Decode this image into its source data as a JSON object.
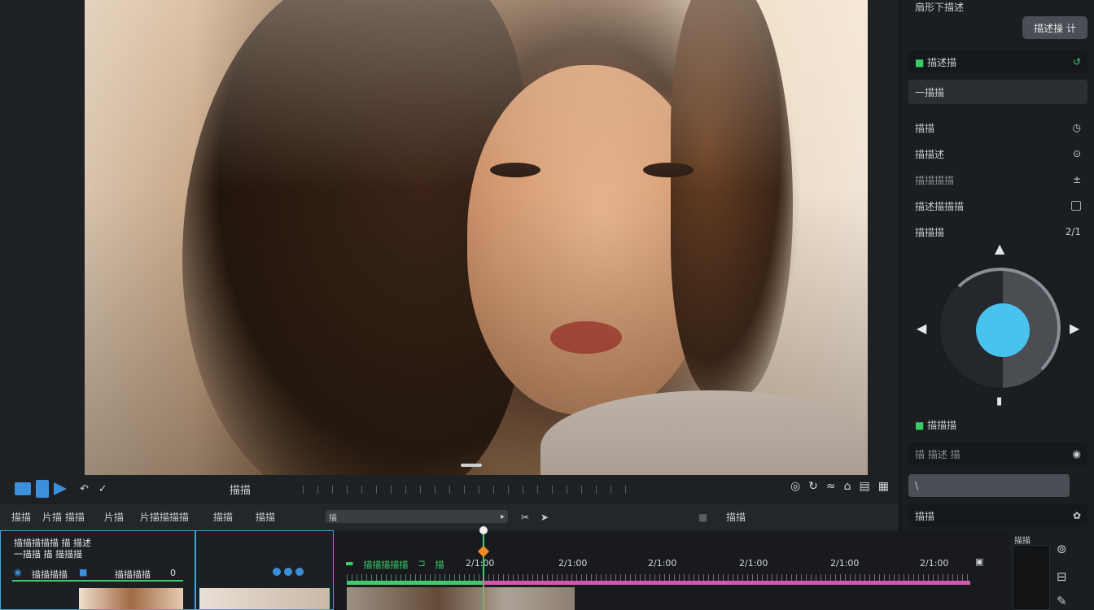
{
  "right_panel": {
    "header_text": "扇形下描述",
    "apply_button": "描述操 计",
    "section_effects": {
      "label": "描述描",
      "reset_icon": "reset-green-icon"
    },
    "dropdown_value": "一描描",
    "rows": [
      {
        "label": "描描",
        "icon": "clock-icon"
      },
      {
        "label": "描描述",
        "icon": "target-icon"
      },
      {
        "label": "描描描描",
        "icon": "plus-minus-icon"
      },
      {
        "label": "描述描描描",
        "icon": "checkbox-icon"
      },
      {
        "label": "描描描",
        "value": "2/1"
      }
    ],
    "section_color": {
      "label": "描描描"
    },
    "field1": {
      "label": "描 描述 描",
      "icon": "record-icon"
    },
    "field2": {
      "label": "\\"
    },
    "field3": {
      "label": "描描",
      "icon": "settings-icon"
    }
  },
  "toolbar1": {
    "center_label": "描描",
    "right_icons": [
      "circle-icon",
      "refresh-icon",
      "tune-icon",
      "home-icon",
      "layout-icon",
      "grid-icon"
    ]
  },
  "toolbar2": {
    "items": [
      "描描",
      "片描 描描",
      "片描",
      "片描描描描",
      "描描",
      "描描"
    ],
    "field_value": "描",
    "trailing": "描描"
  },
  "clip1": {
    "line1": "描描描描描 描 描述",
    "line2": "一描描 描 描描描",
    "line3": "描描描描",
    "line4": "描描描描",
    "count": "0"
  },
  "timeline": {
    "header_labels": [
      "描描描描描",
      "描"
    ],
    "timecodes": [
      "2/1:00",
      "2/1:00",
      "2/1:00",
      "2/1:00",
      "2/1:00",
      "2/1:00"
    ]
  },
  "side": {
    "label": "描描"
  }
}
